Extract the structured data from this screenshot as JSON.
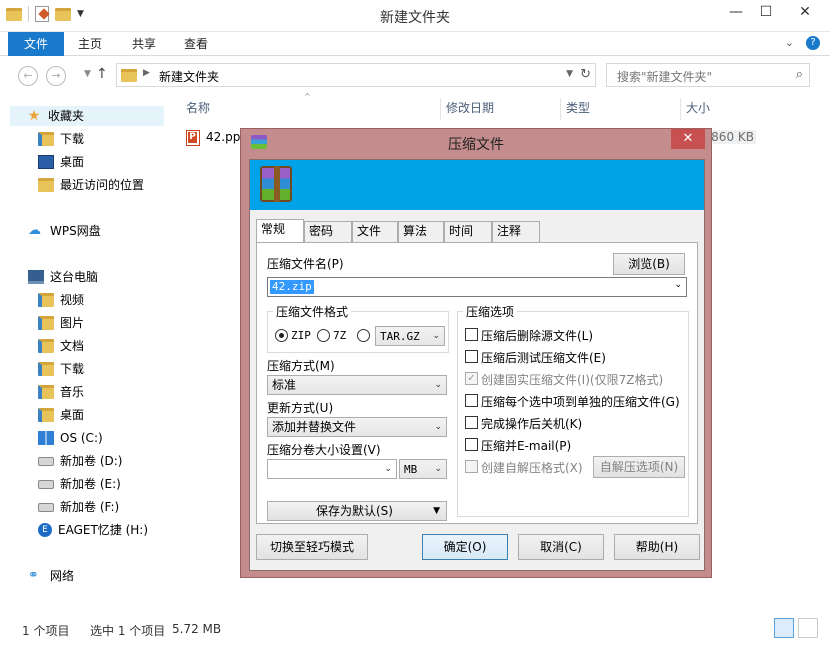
{
  "window": {
    "title": "新建文件夹",
    "minimize": "—",
    "maximize": "☐",
    "close": "✕"
  },
  "ribbon": {
    "tabs": [
      "文件",
      "主页",
      "共享",
      "查看"
    ],
    "expand": "⌄",
    "help": "?"
  },
  "address": {
    "crumb": "新建文件夹",
    "search_placeholder": "搜索\"新建文件夹\""
  },
  "sidebar": {
    "favorites": "收藏夹",
    "downloads": "下载",
    "desktop": "桌面",
    "recent": "最近访问的位置",
    "wps": "WPS网盘",
    "this_pc": "这台电脑",
    "videos": "视频",
    "pictures": "图片",
    "documents": "文档",
    "pc_downloads": "下载",
    "music": "音乐",
    "pc_desktop": "桌面",
    "drive_c": "OS (C:)",
    "drive_d": "新加卷 (D:)",
    "drive_e": "新加卷 (E:)",
    "drive_f": "新加卷 (F:)",
    "drive_h": "EAGET忆捷 (H:)",
    "network": "网络"
  },
  "columns": {
    "name": "名称",
    "modified": "修改日期",
    "type": "类型",
    "size": "大小"
  },
  "file": {
    "name": "42.ppt",
    "size": "860 KB"
  },
  "status": {
    "count": "1 个项目",
    "selected": "选中 1 个项目",
    "size": "5.72 MB"
  },
  "dialog": {
    "title": "压缩文件",
    "close": "✕",
    "tabs": [
      "常规",
      "密码",
      "文件",
      "算法",
      "时间",
      "注释"
    ],
    "archive_name_label": "压缩文件名(P)",
    "browse": "浏览(B)",
    "archive_name": "42.zip",
    "format_group": "压缩文件格式",
    "format_zip": "ZIP",
    "format_7z": "7Z",
    "format_targz": "TAR.GZ",
    "method_label": "压缩方式(M)",
    "method_value": "标准",
    "update_label": "更新方式(U)",
    "update_value": "添加并替换文件",
    "split_label": "压缩分卷大小设置(V)",
    "split_unit": "MB",
    "save_default": "保存为默认(S)",
    "options_group": "压缩选项",
    "opt_delete": "压缩后删除源文件(L)",
    "opt_test": "压缩后测试压缩文件(E)",
    "opt_solid": "创建固实压缩文件(I)(仅限7Z格式)",
    "opt_each": "压缩每个选中项到单独的压缩文件(G)",
    "opt_shutdown": "完成操作后关机(K)",
    "opt_email": "压缩并E-mail(P)",
    "opt_sfx": "创建自解压格式(X)",
    "sfx_options": "自解压选项(N)",
    "switch_mode": "切换至轻巧模式",
    "ok": "确定(O)",
    "cancel": "取消(C)",
    "help": "帮助(H)"
  }
}
